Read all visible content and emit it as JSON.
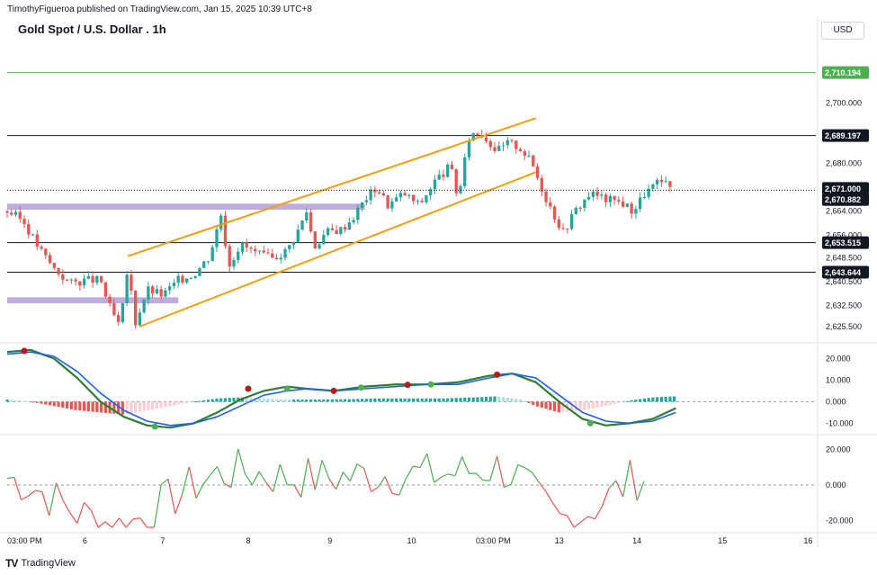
{
  "header": {
    "publisher": "TimothyFigueroa published on TradingView.com, Jan 15, 2025 10:39 UTC+8",
    "title": "Gold Spot / U.S. Dollar . 1h",
    "currency_button": "USD"
  },
  "footer": {
    "brand": "TradingView"
  },
  "colors": {
    "up": "#26a69a",
    "down": "#ef5350",
    "trend": "#f59e0b",
    "zone": "#b39ddb",
    "green_line": "#4caf50"
  },
  "chart_data": [
    {
      "type": "candlestick",
      "title": "Gold Spot / U.S. Dollar . 1h",
      "ylim": [
        2621,
        2720
      ],
      "y_ticks": [
        "2,700.000",
        "2,680.000",
        "2,664.000",
        "2,656.000",
        "2,648.500",
        "2,640.500",
        "2,632.500",
        "2,625.500"
      ],
      "y_tick_values": [
        2700,
        2680,
        2664,
        2656,
        2648.5,
        2640.5,
        2632.5,
        2625.5
      ],
      "x_labels": [
        "03:00 PM",
        "6",
        "7",
        "8",
        "9",
        "10",
        "03:00 PM",
        "13",
        "14",
        "15",
        "16"
      ],
      "x_label_positions": [
        0,
        10,
        20,
        31,
        41.5,
        52,
        62.5,
        71,
        81,
        92,
        103
      ],
      "x_range": [
        0,
        104
      ],
      "horizontal_lines": [
        {
          "value": 2710.194,
          "label": "2,710.194",
          "color": "#4caf50"
        },
        {
          "value": 2689.197,
          "label": "2,689.197",
          "color": "#131722"
        },
        {
          "value": 2653.515,
          "label": "2,653.515",
          "color": "#131722"
        },
        {
          "value": 2643.644,
          "label": "2,643.644",
          "color": "#131722"
        }
      ],
      "price_labels": [
        {
          "value": 2671.0,
          "label": "2,671.000"
        },
        {
          "value": 2670.882,
          "label": "2,670.882"
        }
      ],
      "zones": [
        {
          "x0": 0,
          "x1": 46,
          "y0": 2664.5,
          "y1": 2666.5
        },
        {
          "x0": 0,
          "x1": 22,
          "y0": 2633.3,
          "y1": 2635.3
        }
      ],
      "trend_lines": [
        {
          "x0": 15.5,
          "y0": 2649,
          "x1": 68,
          "y1": 2695
        },
        {
          "x0": 17,
          "y0": 2625.5,
          "x1": 68,
          "y1": 2677
        }
      ],
      "close_anchors": [
        [
          0,
          2664
        ],
        [
          2,
          2661
        ],
        [
          4,
          2652
        ],
        [
          6,
          2645
        ],
        [
          8,
          2640
        ],
        [
          10,
          2641
        ],
        [
          12,
          2641
        ],
        [
          13,
          2633
        ],
        [
          14.5,
          2625
        ],
        [
          15.5,
          2645
        ],
        [
          16.5,
          2627
        ],
        [
          18,
          2638
        ],
        [
          20,
          2636
        ],
        [
          22,
          2641
        ],
        [
          24,
          2643
        ],
        [
          26,
          2649
        ],
        [
          27.5,
          2663
        ],
        [
          28.5,
          2646
        ],
        [
          30,
          2653
        ],
        [
          32,
          2650
        ],
        [
          34,
          2648
        ],
        [
          36,
          2651
        ],
        [
          37.5,
          2658
        ],
        [
          38.5,
          2664
        ],
        [
          39.5,
          2652
        ],
        [
          41,
          2657
        ],
        [
          43,
          2658
        ],
        [
          44.5,
          2662
        ],
        [
          46,
          2668
        ],
        [
          47.5,
          2672
        ],
        [
          49,
          2666
        ],
        [
          51,
          2670
        ],
        [
          53,
          2666
        ],
        [
          55,
          2674
        ],
        [
          57,
          2679
        ],
        [
          58,
          2668
        ],
        [
          59.5,
          2690
        ],
        [
          61,
          2690
        ],
        [
          63,
          2684
        ],
        [
          64.5,
          2687
        ],
        [
          66,
          2685
        ],
        [
          67.5,
          2680
        ],
        [
          69,
          2670
        ],
        [
          70.5,
          2662
        ],
        [
          71.5,
          2657
        ],
        [
          73,
          2664
        ],
        [
          75,
          2670
        ],
        [
          77,
          2668
        ],
        [
          79,
          2667
        ],
        [
          80.5,
          2664
        ],
        [
          82,
          2670
        ],
        [
          84,
          2674
        ],
        [
          85.5,
          2671
        ]
      ]
    },
    {
      "type": "line",
      "ylim": [
        -14,
        26
      ],
      "y_ticks": [
        "20.000",
        "10.000",
        "0.000",
        "-10.000"
      ],
      "y_tick_values": [
        20,
        10,
        0,
        -10
      ],
      "series": [
        {
          "role": "fast",
          "color": "#2e7d32",
          "points": [
            [
              0,
              23
            ],
            [
              3,
              24
            ],
            [
              6,
              20
            ],
            [
              9,
              11
            ],
            [
              12,
              0
            ],
            [
              15,
              -7
            ],
            [
              18,
              -11
            ],
            [
              21,
              -12
            ],
            [
              24,
              -10
            ],
            [
              27,
              -5
            ],
            [
              30,
              1
            ],
            [
              33,
              5
            ],
            [
              36,
              7
            ],
            [
              38.5,
              6
            ],
            [
              42,
              5
            ],
            [
              46,
              7
            ],
            [
              50,
              8
            ],
            [
              54,
              8
            ],
            [
              58,
              9
            ],
            [
              62,
              12
            ],
            [
              65,
              13
            ],
            [
              68,
              9
            ],
            [
              71,
              0
            ],
            [
              74,
              -8
            ],
            [
              77,
              -11
            ],
            [
              80,
              -10
            ],
            [
              83,
              -8
            ],
            [
              86,
              -3
            ]
          ]
        },
        {
          "role": "slow",
          "color": "#1e5eff",
          "points": [
            [
              0,
              22
            ],
            [
              3,
              23
            ],
            [
              6,
              21
            ],
            [
              9,
              14
            ],
            [
              12,
              4
            ],
            [
              15,
              -4
            ],
            [
              18,
              -9
            ],
            [
              21,
              -11
            ],
            [
              24,
              -10
            ],
            [
              27,
              -7
            ],
            [
              30,
              -2
            ],
            [
              33,
              3
            ],
            [
              36,
              5
            ],
            [
              38.5,
              6
            ],
            [
              42,
              5
            ],
            [
              46,
              6
            ],
            [
              50,
              7
            ],
            [
              54,
              8
            ],
            [
              58,
              8
            ],
            [
              62,
              11
            ],
            [
              65,
              13
            ],
            [
              68,
              11
            ],
            [
              71,
              3
            ],
            [
              74,
              -5
            ],
            [
              77,
              -9
            ],
            [
              80,
              -10
            ],
            [
              83,
              -9
            ],
            [
              86,
              -5
            ]
          ]
        }
      ],
      "histogram": {
        "x0": 0,
        "x1": 86,
        "values_anchor": [
          [
            0,
            1
          ],
          [
            3,
            0
          ],
          [
            6,
            -2
          ],
          [
            9,
            -4
          ],
          [
            12,
            -5
          ],
          [
            15,
            -6
          ],
          [
            18,
            -4
          ],
          [
            21,
            -2
          ],
          [
            24,
            0
          ],
          [
            27,
            1.5
          ],
          [
            30,
            2
          ],
          [
            33,
            1.5
          ],
          [
            36,
            1
          ],
          [
            40,
            1
          ],
          [
            44,
            1.2
          ],
          [
            48,
            1.5
          ],
          [
            52,
            1.5
          ],
          [
            56,
            1.5
          ],
          [
            60,
            2
          ],
          [
            63,
            2.5
          ],
          [
            66,
            1
          ],
          [
            68,
            -2
          ],
          [
            71,
            -5
          ],
          [
            74,
            -4
          ],
          [
            77,
            -2
          ],
          [
            80,
            0.5
          ],
          [
            83,
            2
          ],
          [
            86,
            2.5
          ]
        ]
      }
    },
    {
      "type": "line",
      "ylim": [
        -27,
        27
      ],
      "y_ticks": [
        "20.000",
        "0.000",
        "-20.000"
      ],
      "y_tick_values": [
        20,
        0,
        -20
      ],
      "series": [
        {
          "role": "oscillator",
          "color_up": "#4caf50",
          "color_down": "#ef5350",
          "seed": 7
        }
      ]
    }
  ]
}
